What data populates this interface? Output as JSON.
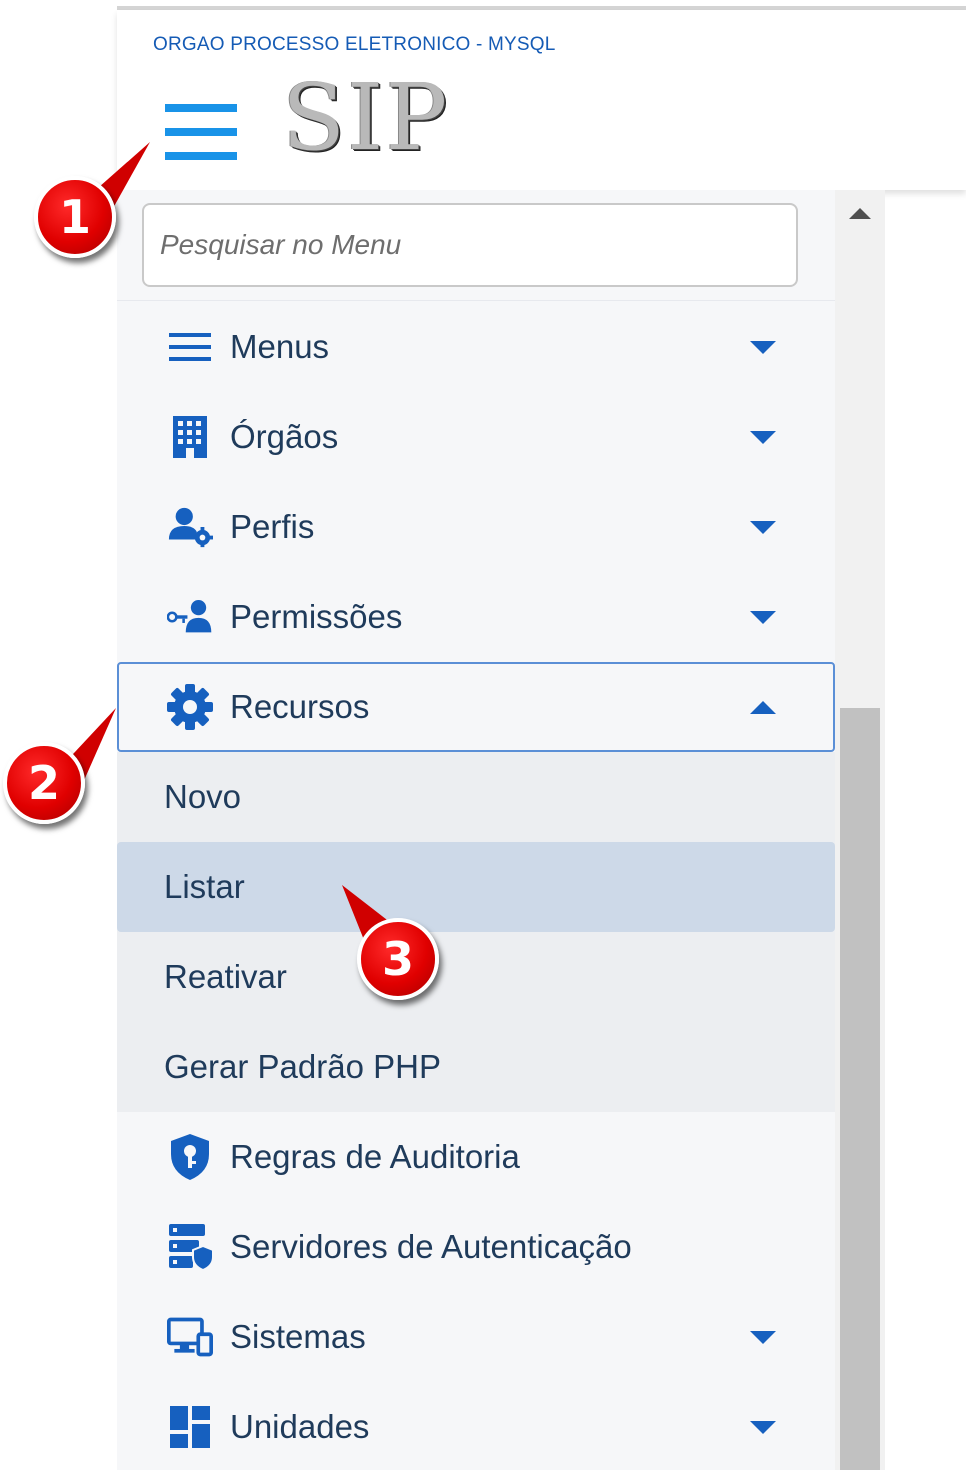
{
  "header": {
    "org_name": "ORGAO PROCESSO ELETRONICO - MYSQL",
    "logo_text": "SIP"
  },
  "search": {
    "placeholder": "Pesquisar no Menu"
  },
  "menu": [
    {
      "label": "Menus",
      "icon": "list-icon",
      "expandable": true
    },
    {
      "label": "Órgãos",
      "icon": "building-icon",
      "expandable": true
    },
    {
      "label": "Perfis",
      "icon": "user-gear-icon",
      "expandable": true
    },
    {
      "label": "Permissões",
      "icon": "user-key-icon",
      "expandable": true
    },
    {
      "label": "Recursos",
      "icon": "gear-icon",
      "expandable": true,
      "expanded": true,
      "children": [
        "Novo",
        "Listar",
        "Reativar",
        "Gerar Padrão PHP"
      ]
    },
    {
      "label": "Regras de Auditoria",
      "icon": "shield-key-icon",
      "expandable": false
    },
    {
      "label": "Servidores de Autenticação",
      "icon": "server-shield-icon",
      "expandable": false
    },
    {
      "label": "Sistemas",
      "icon": "devices-icon",
      "expandable": true
    },
    {
      "label": "Unidades",
      "icon": "dashboard-icon",
      "expandable": true
    }
  ],
  "annotations": [
    "1",
    "2",
    "3"
  ],
  "colors": {
    "accent": "#1993e8",
    "link": "#1660bf",
    "text": "#1f3b5b",
    "badge": "#e00000",
    "hover": "#cdd9e8"
  }
}
